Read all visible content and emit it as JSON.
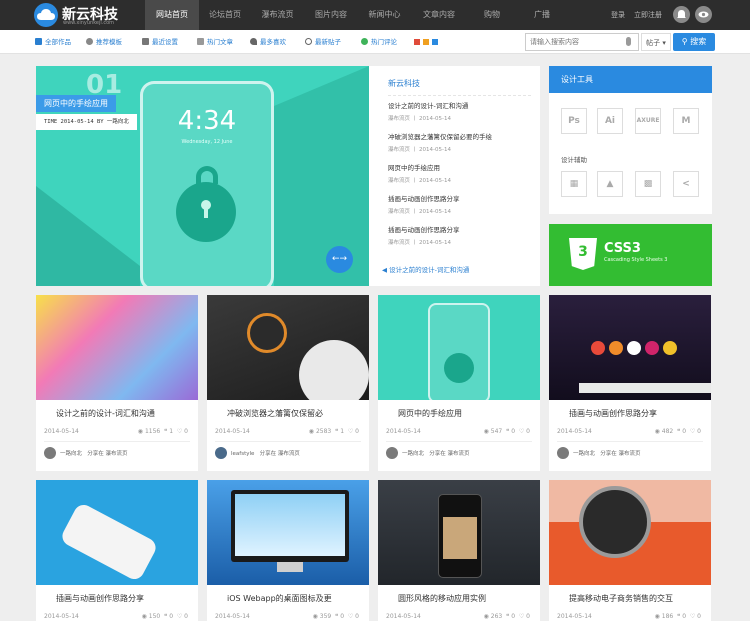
{
  "colors": {
    "accent": "#2a8ae0",
    "topbar": "#2d2d2d",
    "hero": "#3fd4bd",
    "css3": "#33bd32"
  },
  "logo": {
    "title": "新云科技",
    "url": "www.xinyunkeji.com"
  },
  "nav": {
    "items": [
      {
        "label": "网站首页",
        "active": true
      },
      {
        "label": "论坛首页"
      },
      {
        "label": "瀑布流页"
      },
      {
        "label": "图片内容"
      },
      {
        "label": "新闻中心"
      },
      {
        "label": "文章内容"
      },
      {
        "label": "购物"
      },
      {
        "label": "广播"
      }
    ]
  },
  "user": {
    "login": "登录",
    "register": "立即注册"
  },
  "categories": [
    {
      "label": "全部作品",
      "icon": "grid-icon"
    },
    {
      "label": "推荐模板",
      "icon": "badge-icon"
    },
    {
      "label": "最近设置",
      "icon": "trophy-icon"
    },
    {
      "label": "热门文章",
      "icon": "document-icon"
    },
    {
      "label": "最多喜欢",
      "icon": "heart-icon"
    },
    {
      "label": "最新贴子",
      "icon": "clock-icon"
    },
    {
      "label": "热门评论",
      "icon": "chat-icon"
    }
  ],
  "search": {
    "placeholder": "请输入搜索内容",
    "select": "帖子",
    "button": "搜索"
  },
  "hero": {
    "number": "01",
    "title": "网页中的手绘应用",
    "time": "TIME 2014-05-14 BY 一路向北",
    "phone_time": "4:34",
    "phone_date": "Wednesday, 12 June"
  },
  "news": {
    "title": "新云科技",
    "items": [
      {
        "title": "设计之前的设计-词汇和沟通",
        "meta": "瀑布流页 丨 2014-05-14"
      },
      {
        "title": "冲破浏览器之藩篱仅保留必要的手绘",
        "meta": "瀑布流页 丨 2014-05-14"
      },
      {
        "title": "网页中的手绘应用",
        "meta": "瀑布流页 丨 2014-05-14"
      },
      {
        "title": "插画与动画创作思路分享",
        "meta": "瀑布流页 丨 2014-05-14"
      },
      {
        "title": "插画与动画创作思路分享",
        "meta": "瀑布流页 丨 2014-05-14"
      }
    ],
    "footer": "设计之前的设计-词汇和沟通"
  },
  "tools": {
    "title": "设计工具",
    "row1": [
      "Ps",
      "Ai",
      "AXURE",
      "M"
    ],
    "subtitle": "设计辅助"
  },
  "css3": {
    "title": "CSS3",
    "subtitle": "Cascading Style Sheets 3"
  },
  "cards": [
    {
      "title": "设计之前的设计-词汇和沟通",
      "date": "2014-05-14",
      "views": "1156",
      "comments": "1",
      "likes": "0",
      "author": "一路向北",
      "extra": "分享在 瀑布流页"
    },
    {
      "title": "冲破浏览器之藩篱仅保留必",
      "date": "2014-05-14",
      "views": "2583",
      "comments": "1",
      "likes": "0",
      "author": "leafstyle",
      "extra": "分享在 瀑布流页"
    },
    {
      "title": "网页中的手绘应用",
      "date": "2014-05-14",
      "views": "547",
      "comments": "0",
      "likes": "0",
      "author": "一路向北",
      "extra": "分享在 瀑布流页"
    },
    {
      "title": "插画与动画创作思路分享",
      "date": "2014-05-14",
      "views": "482",
      "comments": "0",
      "likes": "0",
      "author": "一路向北",
      "extra": "分享在 瀑布流页"
    },
    {
      "title": "插画与动画创作思路分享",
      "date": "2014-05-14",
      "views": "150",
      "comments": "0",
      "likes": "0"
    },
    {
      "title": "iOS Webapp的桌面图标及更",
      "date": "2014-05-14",
      "views": "359",
      "comments": "0",
      "likes": "0"
    },
    {
      "title": "圆形风格的移动应用实例",
      "date": "2014-05-14",
      "views": "263",
      "comments": "0",
      "likes": "0"
    },
    {
      "title": "提高移动电子商务销售的交互",
      "date": "2014-05-14",
      "views": "186",
      "comments": "0",
      "likes": "0"
    }
  ]
}
